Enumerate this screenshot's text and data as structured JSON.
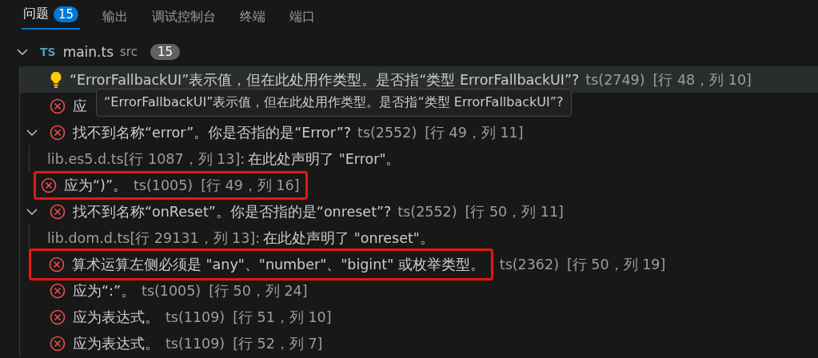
{
  "tabs": [
    {
      "label": "问题",
      "badge": "15",
      "selected": true
    },
    {
      "label": "输出",
      "selected": false
    },
    {
      "label": "调试控制台",
      "selected": false
    },
    {
      "label": "终端",
      "selected": false
    },
    {
      "label": "端口",
      "selected": false
    }
  ],
  "file": {
    "lang": "TS",
    "name": "main.ts",
    "folder": "src",
    "count": "15",
    "expanded": true,
    "children": [
      {
        "kind": "hint",
        "message": "“ErrorFallbackUI”表示值，但在此处用作类型。是否指“类型 ErrorFallbackUI”?",
        "code": "ts(2749)",
        "location": "[行 48，列 10]",
        "hover": true
      },
      {
        "kind": "error",
        "message": "应"
      },
      {
        "kind": "error",
        "message": "找不到名称“error”。你是否指的是“Error”?",
        "code": "ts(2552)",
        "location": "[行 49，列 11]",
        "expanded": true,
        "children": [
          {
            "kind": "related",
            "source": "lib.es5.d.ts[行 1087，列 13]:",
            "message": "在此处声明了 \"Error\"。"
          }
        ]
      },
      {
        "kind": "error",
        "message": "应为“)”。",
        "code": "ts(1005)",
        "location": "[行 49，列 16]",
        "highlighted": true,
        "box_includes_code": true
      },
      {
        "kind": "error",
        "message": "找不到名称“onReset”。你是否指的是“onreset”?",
        "code": "ts(2552)",
        "location": "[行 50，列 11]",
        "expanded": true,
        "children": [
          {
            "kind": "related",
            "source": "lib.dom.d.ts[行 29131，列 13]:",
            "message": "在此处声明了 \"onreset\"。"
          }
        ]
      },
      {
        "kind": "error",
        "message": "算术运算左侧必须是 \"any\"、\"number\"、\"bigint\" 或枚举类型。",
        "code": "ts(2362)",
        "location": "[行 50，列 19]",
        "highlighted": true,
        "box_includes_code": false
      },
      {
        "kind": "error",
        "message": "应为“:”。",
        "code": "ts(1005)",
        "location": "[行 50，列 24]"
      },
      {
        "kind": "error",
        "message": "应为表达式。",
        "code": "ts(1109)",
        "location": "[行 51，列 10]"
      },
      {
        "kind": "error",
        "message": "应为表达式。",
        "code": "ts(1109)",
        "location": "[行 52，列 7]"
      }
    ]
  },
  "tooltip": {
    "text": "“ErrorFallbackUI”表示值，但在此处用作类型。是否指“类型 ErrorFallbackUI”?"
  }
}
